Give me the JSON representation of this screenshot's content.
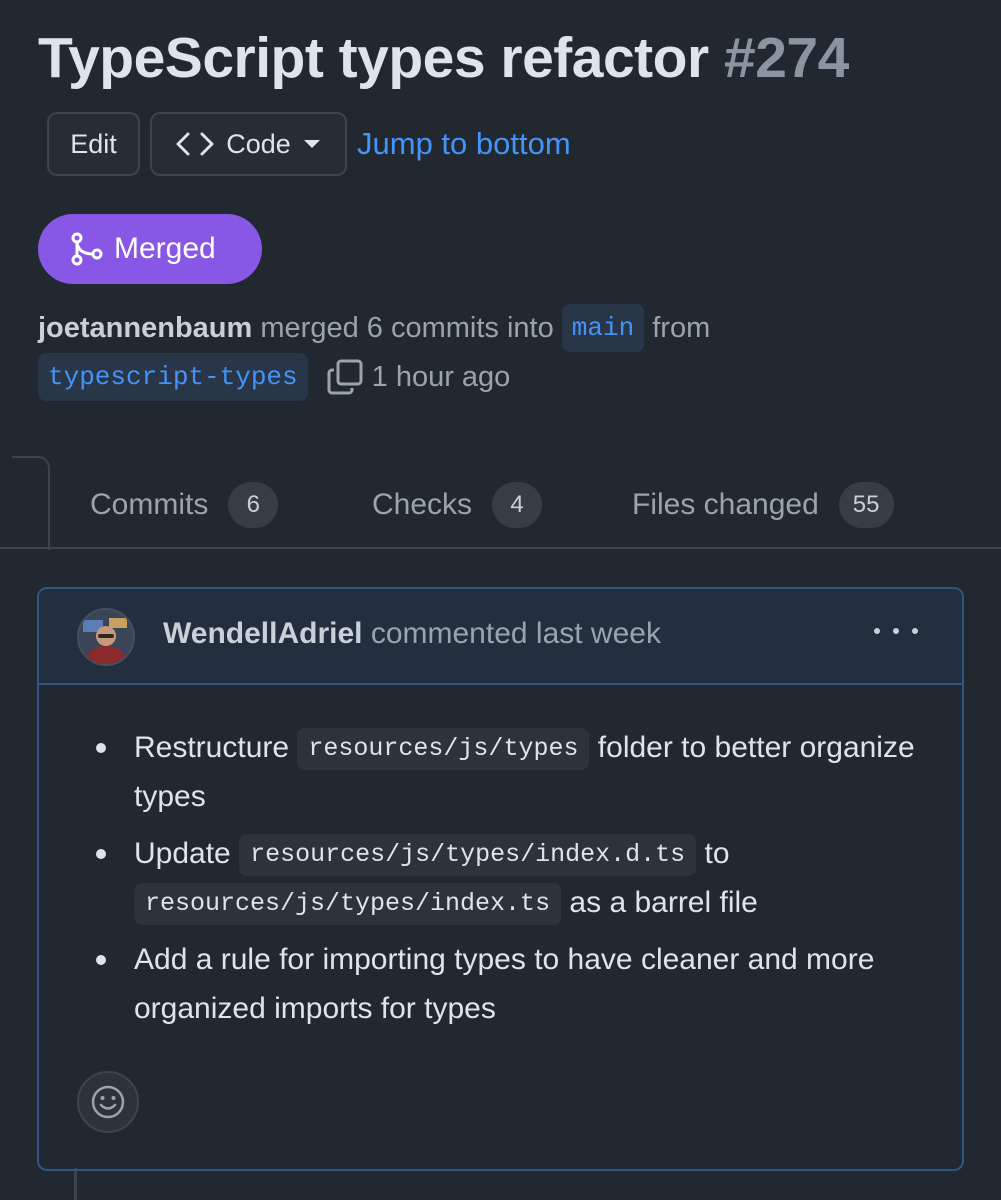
{
  "pr": {
    "title": "TypeScript types refactor",
    "number": "#274"
  },
  "actions": {
    "edit_label": "Edit",
    "code_label": "Code",
    "jump_label": "Jump to bottom"
  },
  "state": {
    "label": "Merged",
    "color": "#8957e5"
  },
  "merge_info": {
    "user": "joetannenbaum",
    "action_text": "merged 6 commits into",
    "base_branch": "main",
    "from_text": "from",
    "head_branch": "typescript-types",
    "time": "1 hour ago"
  },
  "tabs": [
    {
      "label": "Commits",
      "count": "6"
    },
    {
      "label": "Checks",
      "count": "4"
    },
    {
      "label": "Files changed",
      "count": "55"
    }
  ],
  "comment": {
    "author": "WendellAdriel",
    "meta": "commented last week",
    "bullets": [
      {
        "before": "Restructure",
        "code": "resources/js/types",
        "after": "folder to better organize types"
      },
      {
        "before": "Update",
        "code": "resources/js/types/index.d.ts",
        "middle": "to",
        "code2": "resources/js/types/index.ts",
        "after": "as a barrel file"
      },
      {
        "text": "Add a rule for importing types to have cleaner and more organized imports for types"
      }
    ]
  },
  "icons": {
    "code_icon": "code-brackets-icon",
    "dropdown_icon": "triangle-down-icon",
    "merge_icon": "git-merge-icon",
    "copy_icon": "copy-icon",
    "more_icon": "kebab-horizontal-icon",
    "reaction_icon": "smiley-icon"
  }
}
